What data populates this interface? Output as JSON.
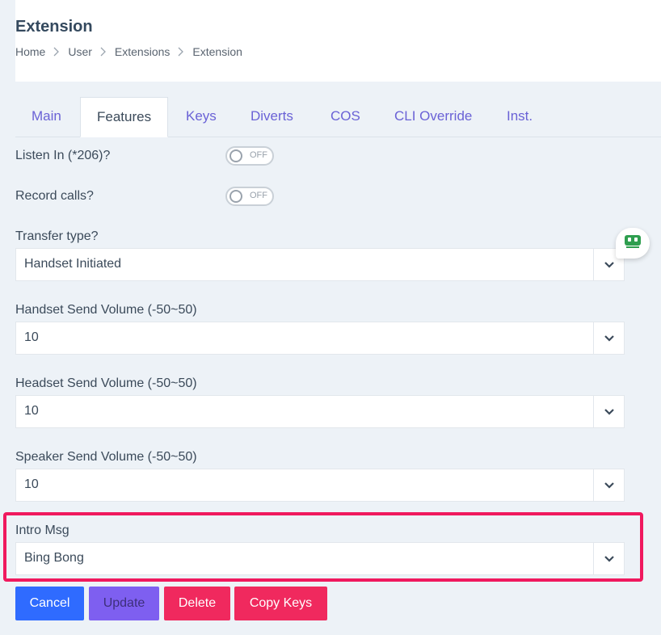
{
  "header": {
    "title": "Extension",
    "breadcrumb": [
      "Home",
      "User",
      "Extensions",
      "Extension"
    ]
  },
  "tabs": [
    {
      "label": "Main",
      "active": false
    },
    {
      "label": "Features",
      "active": true
    },
    {
      "label": "Keys",
      "active": false
    },
    {
      "label": "Diverts",
      "active": false
    },
    {
      "label": "COS",
      "active": false
    },
    {
      "label": "CLI Override",
      "active": false
    },
    {
      "label": "Inst.",
      "active": false
    }
  ],
  "form": {
    "listen_in": {
      "label": "Listen In (*206)?",
      "toggle_text": "OFF"
    },
    "record_calls": {
      "label": "Record calls?",
      "toggle_text": "OFF"
    },
    "transfer_type": {
      "label": "Transfer type?",
      "value": "Handset Initiated"
    },
    "handset_send_volume": {
      "label": "Handset Send Volume (-50~50)",
      "value": "10"
    },
    "headset_send_volume": {
      "label": "Headset Send Volume (-50~50)",
      "value": "10"
    },
    "speaker_send_volume": {
      "label": "Speaker Send Volume (-50~50)",
      "value": "10"
    },
    "intro_msg": {
      "label": "Intro Msg",
      "value": "Bing Bong"
    }
  },
  "buttons": {
    "cancel": "Cancel",
    "update": "Update",
    "delete": "Delete",
    "copy_keys": "Copy Keys"
  },
  "colors": {
    "accent_tab": "#6a62d6",
    "cancel": "#2f6bff",
    "update": "#7e5ff0",
    "danger": "#f0295e",
    "highlight": "#f0195e"
  },
  "icons": {
    "breadcrumb_separator": "chevron-right-icon",
    "select_caret": "chevron-down-icon",
    "floating_widget": "robot-icon"
  }
}
